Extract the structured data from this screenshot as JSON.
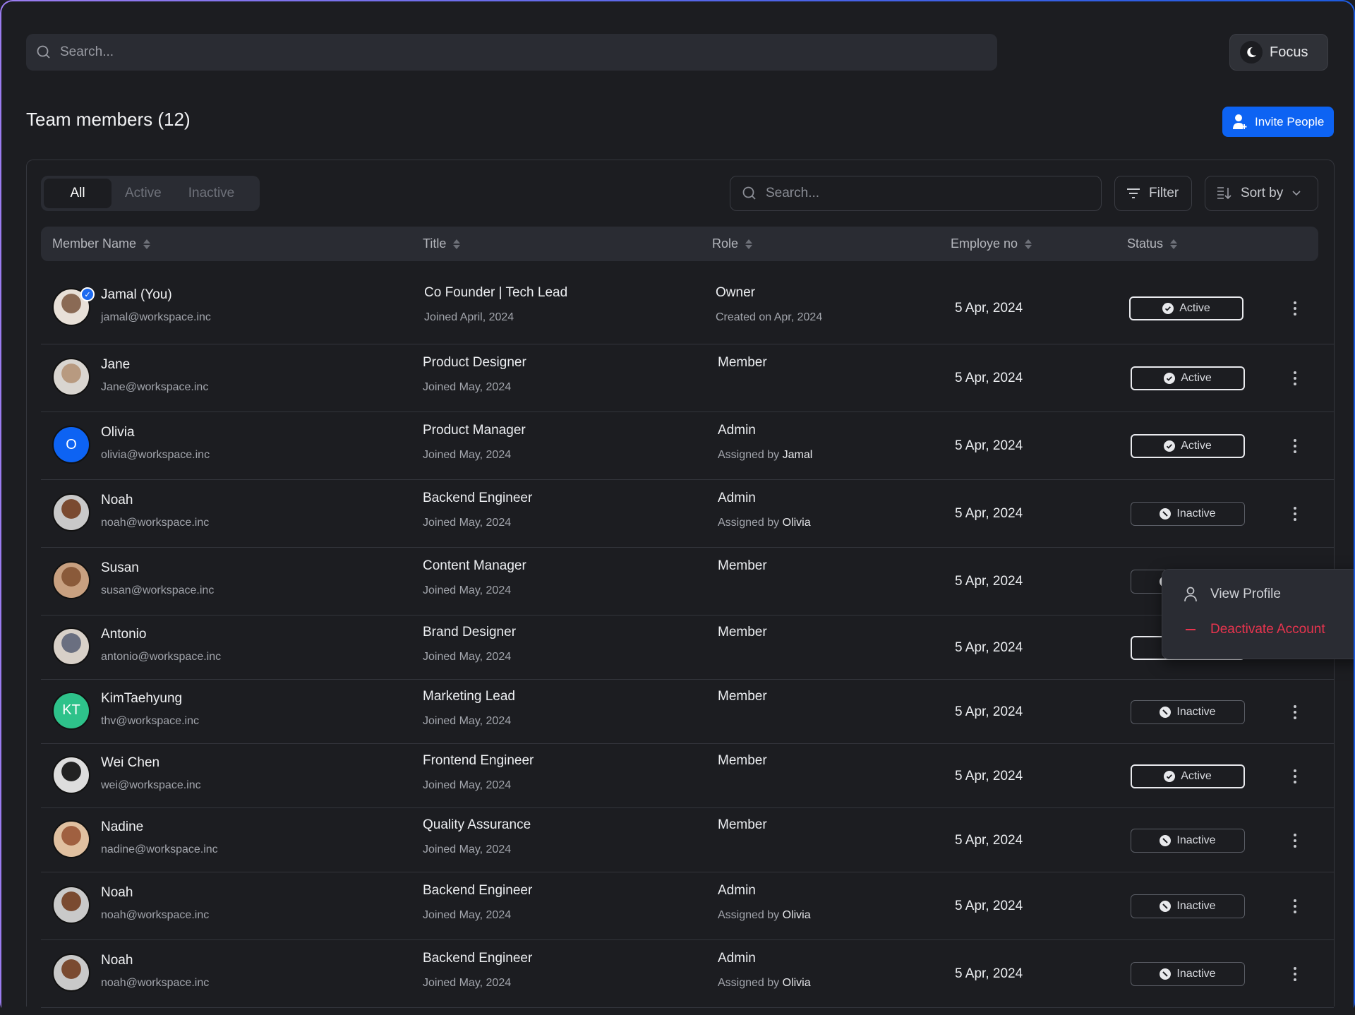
{
  "topbar": {
    "search_placeholder": "Search...",
    "focus_label": "Focus"
  },
  "page": {
    "title": "Team members (12)",
    "invite_label": "Invite People"
  },
  "tabs": [
    {
      "label": "All",
      "selected": true
    },
    {
      "label": "Active",
      "selected": false
    },
    {
      "label": "Inactive",
      "selected": false
    }
  ],
  "toolbar": {
    "search_placeholder": "Search...",
    "filter_label": "Filter",
    "sort_label": "Sort by"
  },
  "columns": [
    "Member Name",
    "Title",
    "Role",
    "Employe no",
    "Status"
  ],
  "colors": {
    "accent": "#0d63f3",
    "danger": "#e8344e",
    "olivia_avatar": "#0d63f3",
    "kt_avatar": "#2ec28a"
  },
  "members": [
    {
      "name": "Jamal (You)",
      "email": "jamal@workspace.inc",
      "title": "Co Founder | Tech Lead",
      "joined": "Joined April, 2024",
      "role": "Owner",
      "role_note": "Created on Apr, 2024",
      "role_by": "",
      "date": "5 Apr, 2024",
      "status": "Active",
      "avatar": "photo",
      "verified": true
    },
    {
      "name": "Jane",
      "email": "Jane@workspace.inc",
      "title": "Product Designer",
      "joined": "Joined May, 2024",
      "role": "Member",
      "role_note": "",
      "role_by": "",
      "date": "5 Apr, 2024",
      "status": "Active",
      "avatar": "photo"
    },
    {
      "name": "Olivia",
      "email": "olivia@workspace.inc",
      "title": "Product Manager",
      "joined": "Joined May, 2024",
      "role": "Admin",
      "role_note": "Assigned by ",
      "role_by": "Jamal",
      "date": "5 Apr, 2024",
      "status": "Active",
      "avatar": "initials",
      "initials": "O"
    },
    {
      "name": "Noah",
      "email": "noah@workspace.inc",
      "title": "Backend Engineer",
      "joined": "Joined May, 2024",
      "role": "Admin",
      "role_note": "Assigned by ",
      "role_by": "Olivia",
      "date": "5 Apr, 2024",
      "status": "Inactive",
      "avatar": "photo"
    },
    {
      "name": "Susan",
      "email": "susan@workspace.inc",
      "title": "Content Manager",
      "joined": "Joined May, 2024",
      "role": "Member",
      "role_note": "",
      "role_by": "",
      "date": "5 Apr, 2024",
      "status": "Inactive",
      "avatar": "photo"
    },
    {
      "name": "Antonio",
      "email": "antonio@workspace.inc",
      "title": "Brand Designer",
      "joined": "Joined May, 2024",
      "role": "Member",
      "role_note": "",
      "role_by": "",
      "date": "5 Apr, 2024",
      "status": "Active",
      "avatar": "photo"
    },
    {
      "name": "KimTaehyung",
      "email": "thv@workspace.inc",
      "title": "Marketing Lead",
      "joined": "Joined May, 2024",
      "role": "Member",
      "role_note": "",
      "role_by": "",
      "date": "5 Apr, 2024",
      "status": "Inactive",
      "avatar": "initials",
      "initials": "KT"
    },
    {
      "name": "Wei Chen",
      "email": "wei@workspace.inc",
      "title": "Frontend Engineer",
      "joined": "Joined May, 2024",
      "role": "Member",
      "role_note": "",
      "role_by": "",
      "date": "5 Apr, 2024",
      "status": "Active",
      "avatar": "photo"
    },
    {
      "name": "Nadine",
      "email": "nadine@workspace.inc",
      "title": "Quality Assurance",
      "joined": "Joined May, 2024",
      "role": "Member",
      "role_note": "",
      "role_by": "",
      "date": "5 Apr, 2024",
      "status": "Inactive",
      "avatar": "photo"
    },
    {
      "name": "Noah",
      "email": "noah@workspace.inc",
      "title": "Backend Engineer",
      "joined": "Joined May, 2024",
      "role": "Admin",
      "role_note": "Assigned by ",
      "role_by": "Olivia",
      "date": "5 Apr, 2024",
      "status": "Inactive",
      "avatar": "photo"
    },
    {
      "name": "Noah",
      "email": "noah@workspace.inc",
      "title": "Backend Engineer",
      "joined": "Joined May, 2024",
      "role": "Admin",
      "role_note": "Assigned by ",
      "role_by": "Olivia",
      "date": "5 Apr, 2024",
      "status": "Inactive",
      "avatar": "photo"
    }
  ],
  "context_menu": {
    "items": [
      {
        "label": "View Profile",
        "icon": "user-icon"
      },
      {
        "label": "Deactivate Account",
        "icon": "minus-icon",
        "danger": true
      }
    ]
  }
}
